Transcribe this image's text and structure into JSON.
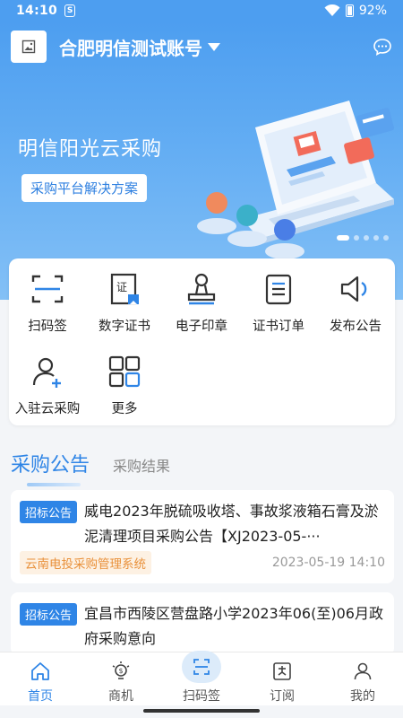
{
  "status": {
    "time": "14:10",
    "sim": "S",
    "battery": "92%"
  },
  "header": {
    "account_name": "合肥明信测试账号"
  },
  "banner": {
    "title": "明信阳光云采购",
    "subtitle": "采购平台解决方案"
  },
  "services": [
    {
      "label": "扫码签",
      "icon": "scan-sign-icon"
    },
    {
      "label": "数字证书",
      "icon": "digital-certificate-icon"
    },
    {
      "label": "电子印章",
      "icon": "electronic-seal-icon"
    },
    {
      "label": "证书订单",
      "icon": "certificate-order-icon"
    },
    {
      "label": "发布公告",
      "icon": "announce-icon"
    },
    {
      "label": "入驻云采购",
      "icon": "add-user-icon"
    },
    {
      "label": "更多",
      "icon": "more-grid-icon"
    }
  ],
  "tabs": {
    "active": "采购公告",
    "inactive": "采购结果"
  },
  "notices": [
    {
      "tag": "招标公告",
      "title": "威电2023年脱硫吸收塔、事故浆液箱石膏及淤泥清理项目采购公告【XJ2023-05-···",
      "source": "云南电投采购管理系统",
      "date": "2023-05-19 14:10"
    },
    {
      "tag": "招标公告",
      "title": "宜昌市西陵区营盘路小学2023年06(至)06月政府采购意向"
    }
  ],
  "nav": [
    {
      "label": "首页",
      "icon": "home-icon"
    },
    {
      "label": "商机",
      "icon": "bulb-icon"
    },
    {
      "label": "扫码签",
      "icon": "scan-icon"
    },
    {
      "label": "订阅",
      "icon": "subscribe-icon"
    },
    {
      "label": "我的",
      "icon": "profile-icon"
    }
  ],
  "colors": {
    "primary": "#2f85e6",
    "banner": "#4d9ef0",
    "source_tag": "#e9913b"
  }
}
